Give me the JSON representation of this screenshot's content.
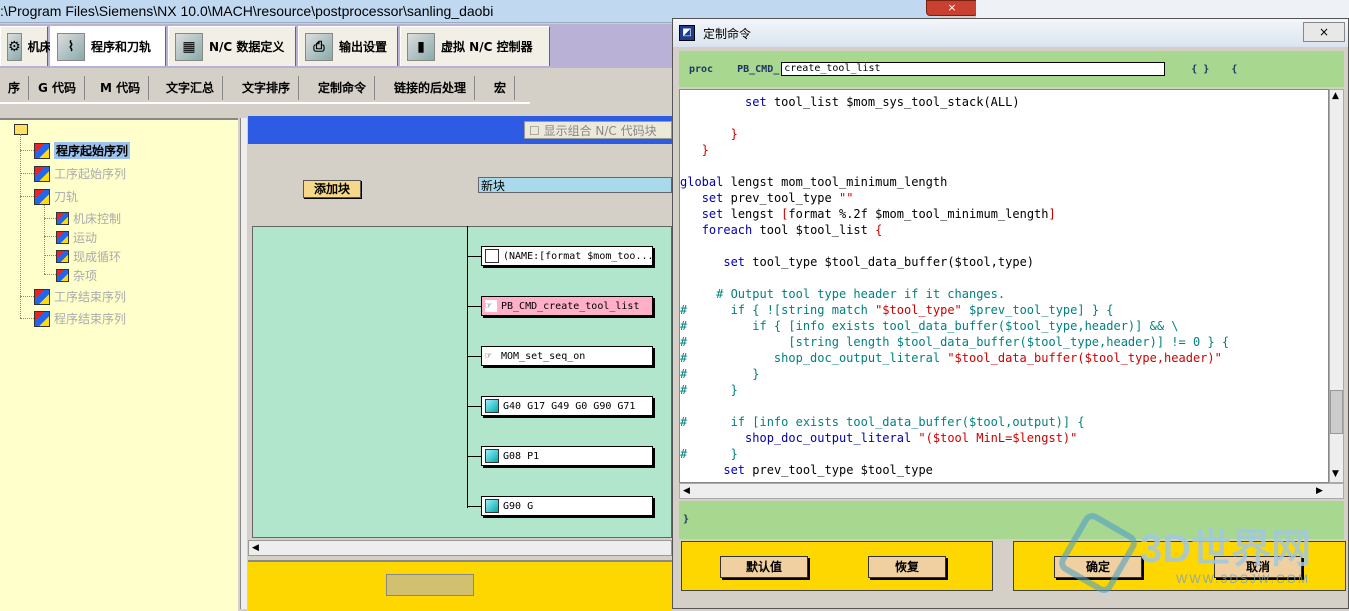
{
  "window": {
    "path": ":\\Program Files\\Siemens\\NX 10.0\\MACH\\resource\\postprocessor\\sanling_daobi",
    "close_label": "×"
  },
  "main_tabs": [
    {
      "label": "机床",
      "icon": "machine-tool-icon"
    },
    {
      "label": "程序和刀轨",
      "icon": "program-toolpath-icon"
    },
    {
      "label": "N/C 数据定义",
      "icon": "nc-data-icon"
    },
    {
      "label": "输出设置",
      "icon": "printer-icon"
    },
    {
      "label": "虚拟 N/C 控制器",
      "icon": "virtual-controller-icon"
    }
  ],
  "sub_tabs": [
    "序",
    "G 代码",
    "M 代码",
    "文字汇总",
    "文字排序",
    "定制命令",
    "链接的后处理",
    "宏"
  ],
  "tree": {
    "items": [
      {
        "label": "程序起始序列",
        "active": true
      },
      {
        "label": "工序起始序列",
        "active": false
      },
      {
        "label": "刀轨",
        "active": false
      },
      {
        "label": "机床控制",
        "active": false
      },
      {
        "label": "运动",
        "active": false
      },
      {
        "label": "现成循环",
        "active": false
      },
      {
        "label": "杂项",
        "active": false
      },
      {
        "label": "工序结束序列",
        "active": false
      },
      {
        "label": "程序结束序列",
        "active": false
      }
    ]
  },
  "toolbar": {
    "show_combined": "显示组合 N/C 代码块",
    "add_block": "添加块",
    "new_block_value": "新块"
  },
  "blocks": [
    {
      "label": "(NAME:[format $mom_too...",
      "icon": "document-icon",
      "selected": false
    },
    {
      "label": "PB_CMD_create_tool_list",
      "icon": "hand-icon",
      "selected": true
    },
    {
      "label": "MOM_set_seq_on",
      "icon": "hand-icon",
      "selected": false
    },
    {
      "label": "G40 G17 G49 G0 G90 G71",
      "icon": "block-icon",
      "selected": false
    },
    {
      "label": "G08 P1",
      "icon": "block-icon",
      "selected": false
    },
    {
      "label": "G90 G",
      "icon": "block-icon",
      "selected": false
    }
  ],
  "dialog": {
    "title": "定制命令",
    "close_label": "×",
    "proc_keyword": "proc",
    "proc_prefix": "PB_CMD_",
    "proc_name": "create_tool_list",
    "proc_braces": "{ }",
    "proc_open": "{",
    "closing_brace": "}",
    "code_lines": [
      [
        {
          "t": "         "
        },
        {
          "t": "set",
          "c": "k"
        },
        {
          "t": " tool_list $mom_sys_tool_stack(ALL)"
        }
      ],
      [
        {
          "t": ""
        }
      ],
      [
        {
          "t": "       }",
          "c": "r"
        }
      ],
      [
        {
          "t": "   }",
          "c": "r"
        }
      ],
      [
        {
          "t": ""
        }
      ],
      [
        {
          "t": "global",
          "c": "k"
        },
        {
          "t": " lengst mom_tool_minimum_length"
        }
      ],
      [
        {
          "t": "   "
        },
        {
          "t": "set",
          "c": "k"
        },
        {
          "t": " prev_tool_type "
        },
        {
          "t": "\"\"",
          "c": "r"
        }
      ],
      [
        {
          "t": "   "
        },
        {
          "t": "set",
          "c": "k"
        },
        {
          "t": " lengst "
        },
        {
          "t": "[",
          "c": "r"
        },
        {
          "t": "format %.2f $mom_tool_minimum_length"
        },
        {
          "t": "]",
          "c": "r"
        }
      ],
      [
        {
          "t": "   "
        },
        {
          "t": "foreach",
          "c": "k"
        },
        {
          "t": " tool $tool_list "
        },
        {
          "t": "{",
          "c": "r"
        }
      ],
      [
        {
          "t": ""
        }
      ],
      [
        {
          "t": "      "
        },
        {
          "t": "set",
          "c": "k"
        },
        {
          "t": " tool_type $tool_data_buffer($tool,type)"
        }
      ],
      [
        {
          "t": ""
        }
      ],
      [
        {
          "t": "     # Output tool type header if it changes.",
          "c": "cm"
        }
      ],
      [
        {
          "t": "#      if { ![string match ",
          "c": "cm"
        },
        {
          "t": "\"$tool_type\"",
          "c": "r"
        },
        {
          "t": " $prev_tool_type] } {",
          "c": "cm"
        }
      ],
      [
        {
          "t": "#         if { [info exists tool_data_buffer($tool_type,header)] && \\",
          "c": "cm"
        }
      ],
      [
        {
          "t": "#              [string length $tool_data_buffer($tool_type,header)] != 0 } {",
          "c": "cm"
        }
      ],
      [
        {
          "t": "#            shop_doc_output_literal ",
          "c": "cm"
        },
        {
          "t": "\"$tool_data_buffer($tool_type,header)\"",
          "c": "r"
        }
      ],
      [
        {
          "t": "#         }",
          "c": "cm"
        }
      ],
      [
        {
          "t": "#      }",
          "c": "cm"
        }
      ],
      [
        {
          "t": ""
        }
      ],
      [
        {
          "t": "#      if [info exists tool_data_buffer($tool,output)] {",
          "c": "cm"
        }
      ],
      [
        {
          "t": "         shop_doc_output_literal ",
          "c": "k"
        },
        {
          "t": "\"($tool MinL=$lengst)\"",
          "c": "r"
        }
      ],
      [
        {
          "t": "#      }",
          "c": "cm"
        }
      ],
      [
        {
          "t": "      "
        },
        {
          "t": "set",
          "c": "k"
        },
        {
          "t": " prev_tool_type $tool_type"
        }
      ]
    ],
    "buttons": {
      "default": "默认值",
      "restore": "恢复",
      "ok": "确定",
      "cancel": "取消"
    }
  },
  "watermark": {
    "text": "3D世界网",
    "url": "WWW.3DSJW.COM"
  }
}
